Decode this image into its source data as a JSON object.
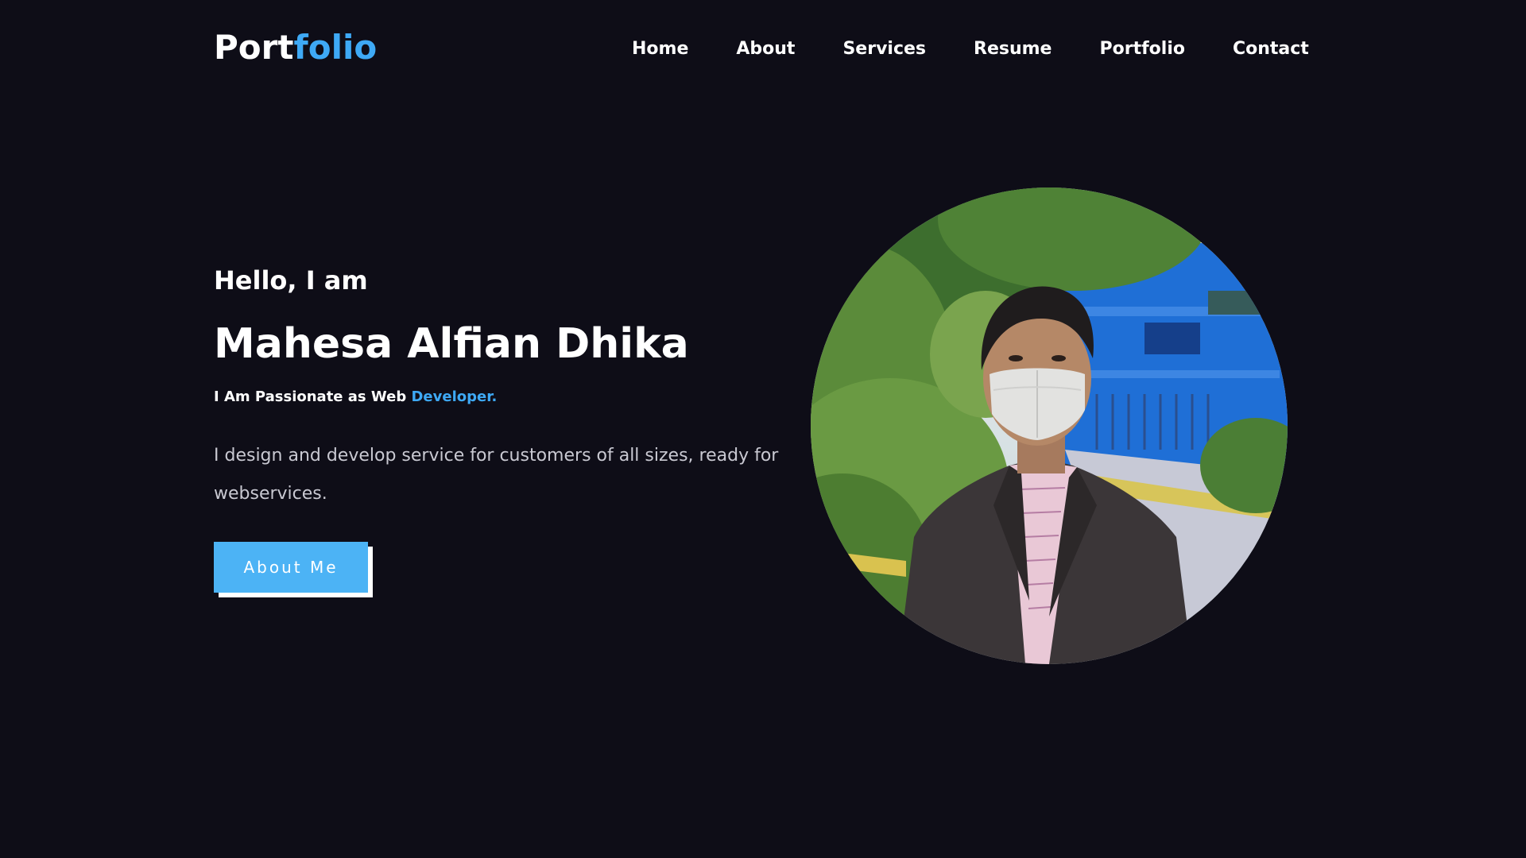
{
  "header": {
    "logo_part1": "Port",
    "logo_part2": "folio",
    "nav": [
      "Home",
      "About",
      "Services",
      "Resume",
      "Portfolio",
      "Contact"
    ]
  },
  "hero": {
    "greeting": "Hello, I am",
    "name": "Mahesa Alfian Dhika",
    "tagline_prefix": "I Am Passionate as Web ",
    "tagline_accent": "Developer.",
    "description": "I design and develop service for customers of all sizes, ready for webservices.",
    "button_label": "About Me"
  },
  "colors": {
    "background": "#0e0d17",
    "accent": "#3ea9f5",
    "button": "#4cb3f5"
  }
}
